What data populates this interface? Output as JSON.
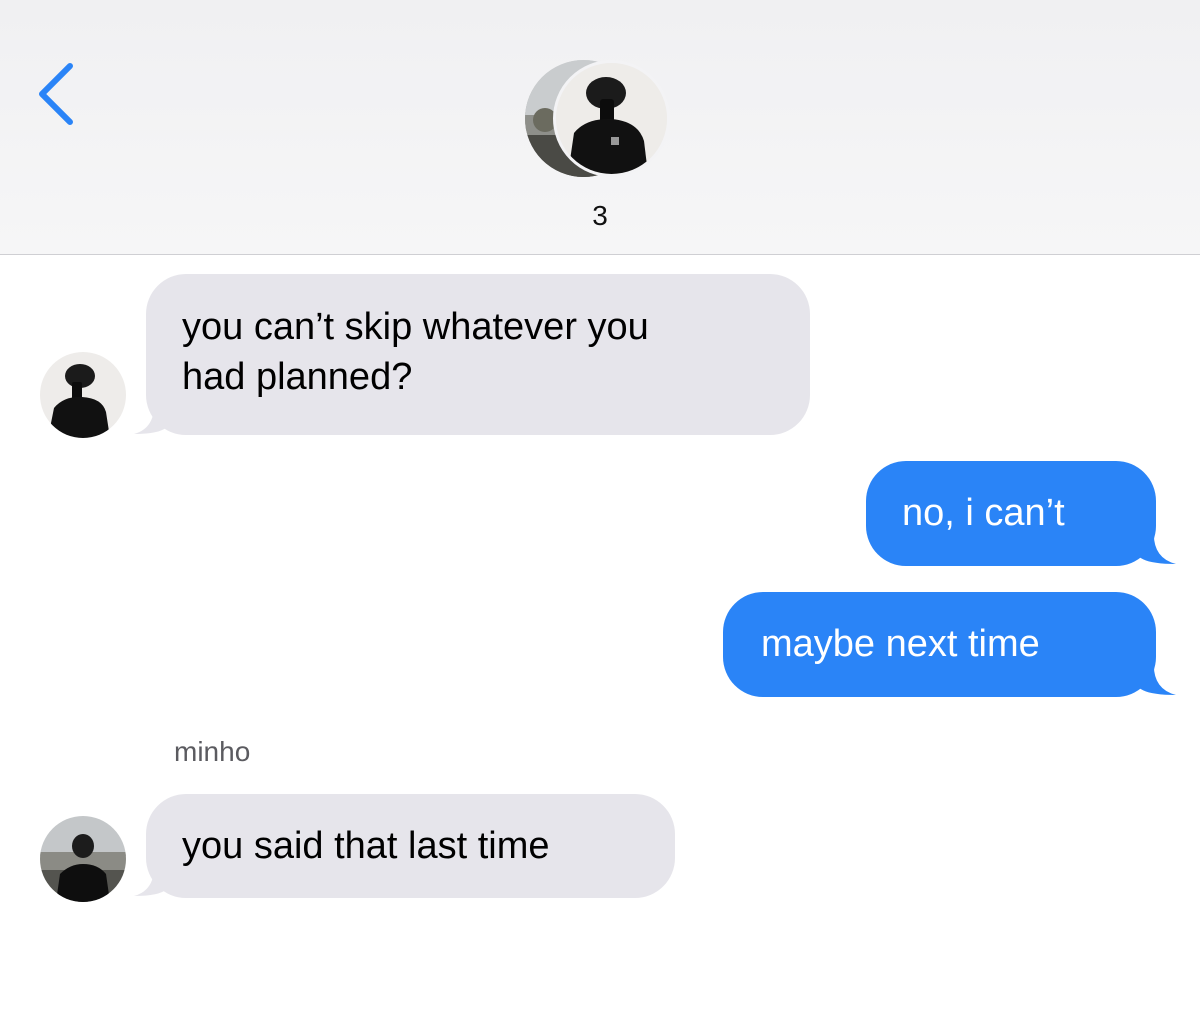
{
  "header": {
    "member_count": "3"
  },
  "colors": {
    "accent": "#2a84f7",
    "incoming_bubble": "#e6e5eb",
    "header_bg": "#f3f3f5"
  },
  "icons": {
    "back": "chevron-left-icon"
  },
  "messages": [
    {
      "direction": "incoming",
      "text": "you can’t skip whatever you\nhad planned?"
    },
    {
      "direction": "outgoing",
      "text": "no, i can’t"
    },
    {
      "direction": "outgoing",
      "text": "maybe next time"
    },
    {
      "direction": "incoming",
      "sender": "minho",
      "text": "you said that last time"
    }
  ]
}
